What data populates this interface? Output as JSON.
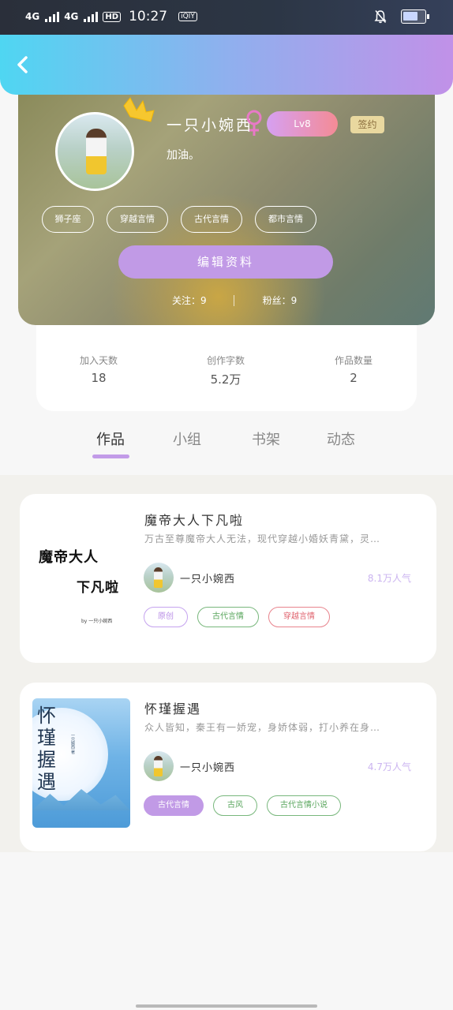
{
  "status_bar": {
    "signal1": "4G",
    "signal2": "4G",
    "hd": "HD",
    "time": "10:27",
    "app_badge": "iQIY"
  },
  "header": {
    "back_icon": "chevron-left-icon"
  },
  "profile": {
    "nickname": "一只小婉西",
    "level": "Lv8",
    "signed_badge": "签约",
    "bio": "加油。",
    "tags": [
      "狮子座",
      "穿越言情",
      "古代言情",
      "都市言情"
    ],
    "edit_button": "编辑资料",
    "follow_text": "关注：9",
    "fans_text": "粉丝：9"
  },
  "stats": [
    {
      "label": "加入天数",
      "value": "18"
    },
    {
      "label": "创作字数",
      "value": "5.2万"
    },
    {
      "label": "作品数量",
      "value": "2"
    }
  ],
  "tabs": [
    "作品",
    "小组",
    "书架",
    "动态"
  ],
  "works": [
    {
      "cover_line1": "魔帝大人",
      "cover_line2": "下凡啦",
      "cover_by": "by 一只小婉西",
      "title": "魔帝大人下凡啦",
      "intro": "万古至尊魔帝大人无法，现代穿越小婚妖青黛，灵…",
      "author": "一只小婉西",
      "popularity": "8.1万人气",
      "tags": [
        "原创",
        "古代言情",
        "穿越言情"
      ]
    },
    {
      "cover_title": "怀瑾握遇",
      "cover_by": "一只婉西 著",
      "title": "怀瑾握遇",
      "intro": "众人皆知，秦王有一娇宠，身娇体弱，打小养在身…",
      "author": "一只小婉西",
      "popularity": "4.7万人气",
      "tags": [
        "古代言情",
        "古风",
        "古代言情小说"
      ]
    }
  ],
  "colors": {
    "accent": "#c19ae6",
    "header_start": "#4fd6f2",
    "header_end": "#c191e8"
  }
}
